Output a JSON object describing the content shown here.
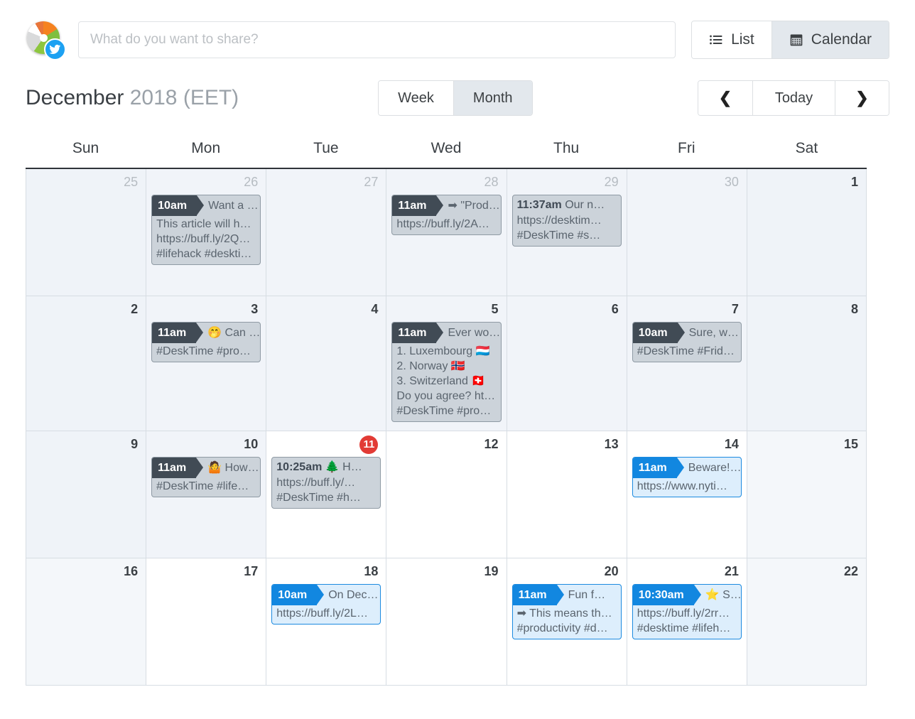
{
  "composer": {
    "placeholder": "What do you want to share?",
    "avatar_icon": "desktime-pie-avatar",
    "network_badge_icon": "twitter-icon"
  },
  "view_toggle": {
    "list_label": "List",
    "list_icon": "list-icon",
    "calendar_label": "Calendar",
    "calendar_icon": "calendar-icon",
    "active": "Calendar"
  },
  "header": {
    "month": "December",
    "year": "2018",
    "timezone": "(EET)"
  },
  "range_toggle": {
    "week_label": "Week",
    "month_label": "Month",
    "active": "Month"
  },
  "nav": {
    "prev_icon": "chevron-left-icon",
    "prev_label": "❮",
    "today_label": "Today",
    "next_icon": "chevron-right-icon",
    "next_label": "❯"
  },
  "colors": {
    "accent_blue": "#1287e0",
    "past_event_bg": "#ccd3da",
    "past_event_border": "#8f9aa4",
    "past_time_bg": "#414b55",
    "future_event_bg": "#ddeefc",
    "future_event_border": "#1b8ae0",
    "today_badge_bg": "#e23b35",
    "past_day_bg": "#f1f4f9"
  },
  "weekdays": [
    "Sun",
    "Mon",
    "Tue",
    "Wed",
    "Thu",
    "Fri",
    "Sat"
  ],
  "weeks": [
    {
      "days": [
        {
          "num": "25",
          "state": "past",
          "other_month": true,
          "weekend": true,
          "events": []
        },
        {
          "num": "26",
          "state": "past",
          "other_month": true,
          "weekend": false,
          "events": [
            {
              "style": "past",
              "time": "10am",
              "time_style": "tag",
              "title": "Want a …",
              "lines": [
                "This article will h…",
                "https://buff.ly/2Q…",
                "#lifehack #deskti…"
              ]
            }
          ]
        },
        {
          "num": "27",
          "state": "past",
          "other_month": true,
          "weekend": false,
          "events": []
        },
        {
          "num": "28",
          "state": "past",
          "other_month": true,
          "weekend": false,
          "events": [
            {
              "style": "past",
              "time": "11am",
              "time_style": "tag",
              "title": "➡ \"Prod…",
              "lines": [
                "https://buff.ly/2A…"
              ]
            }
          ]
        },
        {
          "num": "29",
          "state": "past",
          "other_month": true,
          "weekend": false,
          "events": [
            {
              "style": "past",
              "time": "11:37am",
              "time_style": "inline",
              "title": "Our n…",
              "lines": [
                "https://desktim…",
                "#DeskTime #s…"
              ]
            }
          ]
        },
        {
          "num": "30",
          "state": "past",
          "other_month": true,
          "weekend": false,
          "events": []
        },
        {
          "num": "1",
          "state": "past",
          "other_month": false,
          "weekend": true,
          "events": []
        }
      ]
    },
    {
      "days": [
        {
          "num": "2",
          "state": "past",
          "other_month": false,
          "weekend": true,
          "events": []
        },
        {
          "num": "3",
          "state": "past",
          "other_month": false,
          "weekend": false,
          "events": [
            {
              "style": "past",
              "time": "11am",
              "time_style": "tag",
              "title": "🤭 Can …",
              "lines": [
                "#DeskTime #pro…"
              ]
            }
          ]
        },
        {
          "num": "4",
          "state": "past",
          "other_month": false,
          "weekend": false,
          "events": []
        },
        {
          "num": "5",
          "state": "past",
          "other_month": false,
          "weekend": false,
          "events": [
            {
              "style": "past",
              "time": "11am",
              "time_style": "tag",
              "title": "Ever wo…",
              "lines": [
                "1. Luxembourg 🇱🇺",
                "2. Norway 🇳🇴",
                "3. Switzerland 🇨🇭",
                "Do you agree? ht…",
                "#DeskTime #pro…"
              ]
            }
          ]
        },
        {
          "num": "6",
          "state": "past",
          "other_month": false,
          "weekend": false,
          "events": []
        },
        {
          "num": "7",
          "state": "past",
          "other_month": false,
          "weekend": false,
          "events": [
            {
              "style": "past",
              "time": "10am",
              "time_style": "tag",
              "title": "Sure, w…",
              "lines": [
                "#DeskTime #Frid…"
              ]
            }
          ]
        },
        {
          "num": "8",
          "state": "past",
          "other_month": false,
          "weekend": true,
          "events": []
        }
      ]
    },
    {
      "days": [
        {
          "num": "9",
          "state": "past",
          "other_month": false,
          "weekend": true,
          "events": []
        },
        {
          "num": "10",
          "state": "past",
          "other_month": false,
          "weekend": false,
          "events": [
            {
              "style": "past",
              "time": "11am",
              "time_style": "tag",
              "title": "🤷 How…",
              "lines": [
                "#DeskTime #life…"
              ]
            }
          ]
        },
        {
          "num": "11",
          "state": "today",
          "other_month": false,
          "weekend": false,
          "events": [
            {
              "style": "past",
              "time": "10:25am",
              "time_style": "inline",
              "title": "🌲 H…",
              "lines": [
                "https://buff.ly/…",
                "#DeskTime #h…"
              ]
            }
          ]
        },
        {
          "num": "12",
          "state": "future",
          "other_month": false,
          "weekend": false,
          "events": []
        },
        {
          "num": "13",
          "state": "future",
          "other_month": false,
          "weekend": false,
          "events": []
        },
        {
          "num": "14",
          "state": "future",
          "other_month": false,
          "weekend": false,
          "events": [
            {
              "style": "future",
              "time": "11am",
              "time_style": "tag",
              "title": "Beware!…",
              "lines": [
                "https://www.nyti…"
              ]
            }
          ]
        },
        {
          "num": "15",
          "state": "future",
          "other_month": false,
          "weekend": true,
          "events": []
        }
      ]
    },
    {
      "days": [
        {
          "num": "16",
          "state": "future",
          "other_month": false,
          "weekend": true,
          "events": []
        },
        {
          "num": "17",
          "state": "future",
          "other_month": false,
          "weekend": false,
          "events": []
        },
        {
          "num": "18",
          "state": "future",
          "other_month": false,
          "weekend": false,
          "events": [
            {
              "style": "future",
              "time": "10am",
              "time_style": "tag",
              "title": "On Dec…",
              "lines": [
                "https://buff.ly/2L…"
              ]
            }
          ]
        },
        {
          "num": "19",
          "state": "future",
          "other_month": false,
          "weekend": false,
          "events": []
        },
        {
          "num": "20",
          "state": "future",
          "other_month": false,
          "weekend": false,
          "events": [
            {
              "style": "future",
              "time": "11am",
              "time_style": "tag",
              "title": "Fun f…",
              "lines": [
                "➡ This means th…",
                "#productivity #d…"
              ]
            }
          ]
        },
        {
          "num": "21",
          "state": "future",
          "other_month": false,
          "weekend": false,
          "events": [
            {
              "style": "future",
              "time": "10:30am",
              "time_style": "tag",
              "title": "⭐ S…",
              "lines": [
                "https://buff.ly/2rr…",
                "#desktime #lifeh…"
              ]
            }
          ]
        },
        {
          "num": "22",
          "state": "future",
          "other_month": false,
          "weekend": true,
          "events": []
        }
      ]
    }
  ]
}
